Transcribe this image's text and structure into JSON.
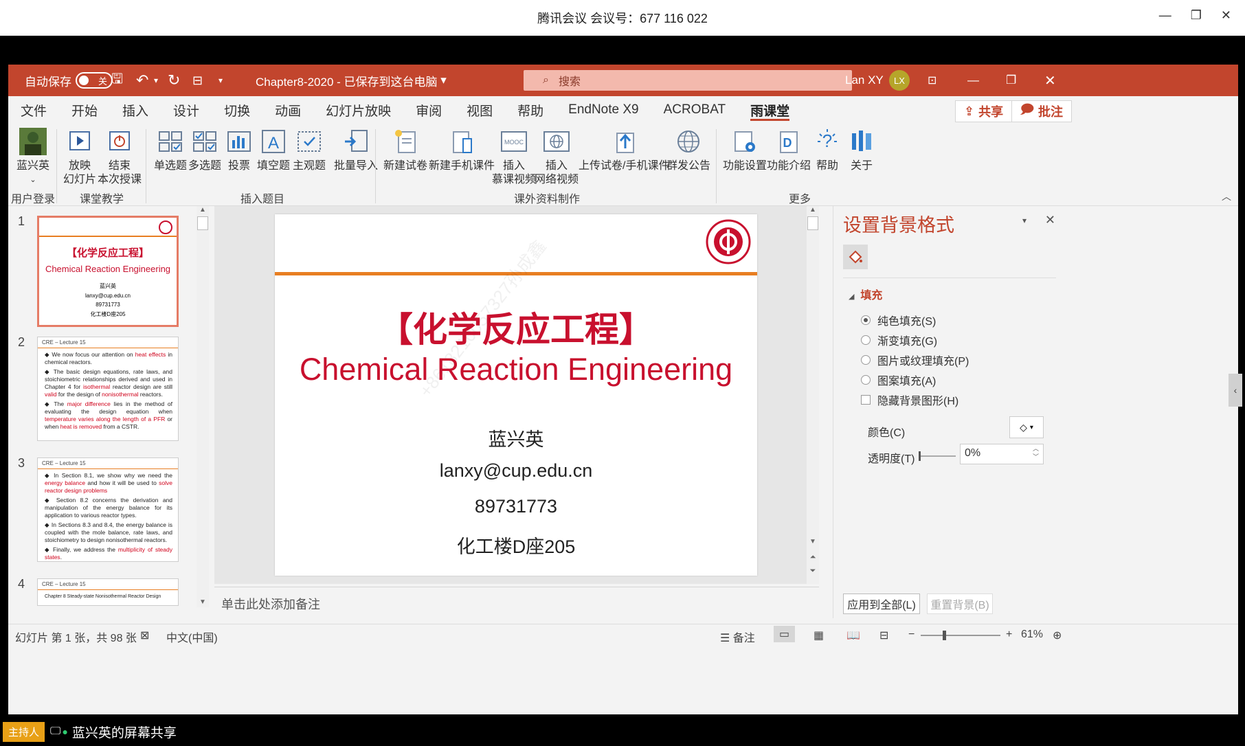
{
  "meeting": {
    "title": "腾讯会议 会议号：677 116 022"
  },
  "titlebar": {
    "autosave_label": "自动保存",
    "autosave_state": "关",
    "doc_title": "Chapter8-2020 - 已保存到这台电脑",
    "search_placeholder": "搜索",
    "user_name": "Lan XY",
    "user_initials": "LX"
  },
  "tabs": [
    "文件",
    "开始",
    "插入",
    "设计",
    "切换",
    "动画",
    "幻灯片放映",
    "审阅",
    "视图",
    "帮助",
    "EndNote X9",
    "ACROBAT",
    "雨课堂"
  ],
  "active_tab": "雨课堂",
  "share": {
    "share_label": "共享",
    "comment_label": "批注"
  },
  "ribbon": {
    "user_login": {
      "label": "蓝兴英",
      "group": "用户登录"
    },
    "classroom": {
      "play_l1": "放映",
      "play_l2": "幻灯片",
      "end_l1": "结束",
      "end_l2": "本次授课",
      "group": "课堂教学"
    },
    "insert_q": {
      "single": "单选题",
      "multi": "多选题",
      "vote": "投票",
      "fill": "填空题",
      "subjective": "主观题",
      "batch": "批量导入",
      "group": "插入题目"
    },
    "extra": {
      "new_exam": "新建试卷",
      "new_mobile": "新建手机课件",
      "mooc_l1": "插入",
      "mooc_l2": "慕课视频",
      "net_l1": "插入",
      "net_l2": "网络视频",
      "upload": "上传试卷/手机课件",
      "notice": "群发公告",
      "group": "课外资料制作"
    },
    "more": {
      "settings": "功能设置",
      "intro": "功能介绍",
      "help": "帮助",
      "about": "关于",
      "group": "更多"
    }
  },
  "thumbnails": {
    "t1": {
      "num": "1",
      "cn": "【化学反应工程】",
      "en": "Chemical Reaction Engineering",
      "name": "蓝兴英",
      "email": "lanxy@cup.edu.cn",
      "phone": "89731773",
      "room": "化工楼D座205"
    },
    "t2": {
      "num": "2",
      "head": "CRE – Lecture 15",
      "p1a": "We now focus our attention on ",
      "p1b": "heat effects",
      "p1c": " in chemical reactors.",
      "p2a": "The basic design equations, rate laws, and stoichiometric relationships derived and used in Chapter 4 for ",
      "p2b": "isothermal",
      "p2c": " reactor design are still ",
      "p2d": "valid",
      "p2e": " for the design of ",
      "p2f": "nonisothermal",
      "p2g": " reactors.",
      "p3a": "The ",
      "p3b": "major difference",
      "p3c": " lies in the method of evaluating the design equation when ",
      "p3d": "temperature varies along the length of a PFR",
      "p3e": " or when ",
      "p3f": "heat is removed",
      "p3g": " from a CSTR."
    },
    "t3": {
      "num": "3",
      "head": "CRE – Lecture 15",
      "p1a": "In Section 8.1, we show why we need the ",
      "p1b": "energy balance",
      "p1c": " and how it will be used to ",
      "p1d": "solve reactor design problems",
      "p2": "Section 8.2 concerns the derivation and manipulation of the energy balance for its application to various reactor types.",
      "p3": "In Sections 8.3 and 8.4, the energy balance is coupled with the mole balance, rate laws, and stoichiometry to design nonisothermal reactors.",
      "p4a": "Finally, we address the ",
      "p4b": "multiplicity of steady states",
      "p4c": "."
    },
    "t4": {
      "num": "4",
      "head": "CRE – Lecture 15",
      "body": "Chapter 8   Steady-state Nonisothermal Reactor Design"
    }
  },
  "slide": {
    "title_cn": "【化学反应工程】",
    "title_en": "Chemical Reaction Engineering",
    "name": "蓝兴英",
    "email": "lanxy@cup.edu.cn",
    "phone": "89731773",
    "room": "化工楼D座205",
    "watermark": "+8618210057327孙成鑫"
  },
  "notes_placeholder": "单击此处添加备注",
  "format_panel": {
    "title": "设置背景格式",
    "section": "填充",
    "options": [
      "纯色填充(S)",
      "渐变填充(G)",
      "图片或纹理填充(P)",
      "图案填充(A)"
    ],
    "selected_option": "纯色填充(S)",
    "hide_bg": "隐藏背景图形(H)",
    "color_label": "颜色(C)",
    "transparency_label": "透明度(T)",
    "transparency_value": "0%",
    "apply_all": "应用到全部(L)",
    "reset_bg": "重置背景(B)"
  },
  "status": {
    "slide_info": "幻灯片 第 1 张，共 98 张",
    "language": "中文(中国)",
    "notes": "备注",
    "zoom": "61%"
  },
  "sharing": {
    "host": "主持人",
    "text": "蓝兴英的屏幕共享"
  },
  "colors": {
    "accent": "#c2452d",
    "slide_red": "#c8102e",
    "orange_line": "#e87e22"
  }
}
